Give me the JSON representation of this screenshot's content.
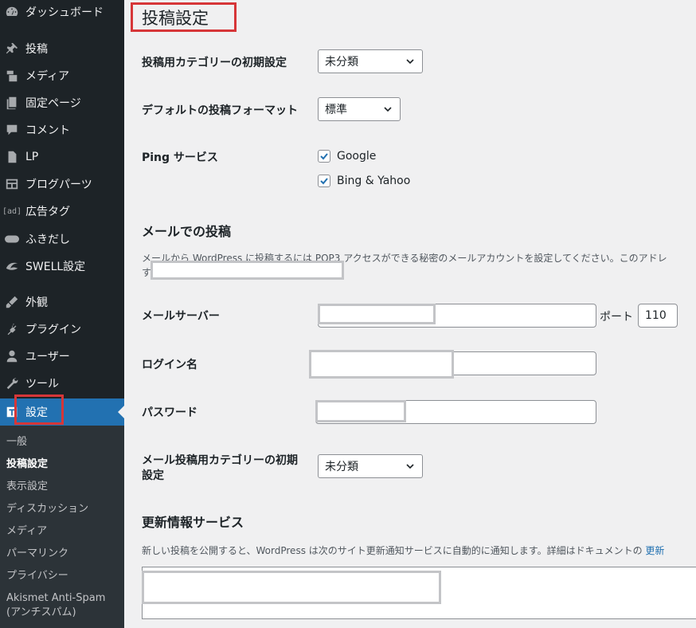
{
  "sidebar": {
    "items": [
      {
        "label": "ダッシュボード",
        "icon": "dashboard-icon"
      },
      {
        "label": "投稿",
        "icon": "pin-icon"
      },
      {
        "label": "メディア",
        "icon": "media-icon"
      },
      {
        "label": "固定ページ",
        "icon": "page-icon"
      },
      {
        "label": "コメント",
        "icon": "comment-icon"
      },
      {
        "label": "LP",
        "icon": "document-icon"
      },
      {
        "label": "ブログパーツ",
        "icon": "layout-icon"
      },
      {
        "label": "広告タグ",
        "icon": "ad-tag-icon",
        "icon_text": "[ad]"
      },
      {
        "label": "ふきだし",
        "icon": "speech-bubble-icon"
      },
      {
        "label": "SWELL設定",
        "icon": "swell-icon"
      },
      {
        "label": "外観",
        "icon": "appearance-icon"
      },
      {
        "label": "プラグイン",
        "icon": "plugin-icon"
      },
      {
        "label": "ユーザー",
        "icon": "user-icon"
      },
      {
        "label": "ツール",
        "icon": "wrench-icon"
      },
      {
        "label": "設定",
        "icon": "settings-icon"
      }
    ],
    "submenu": [
      "一般",
      "投稿設定",
      "表示設定",
      "ディスカッション",
      "メディア",
      "パーマリンク",
      "プライバシー",
      "Akismet Anti-Spam (アンチスパム)"
    ]
  },
  "page": {
    "title": "投稿設定",
    "default_category": {
      "label": "投稿用カテゴリーの初期設定",
      "value": "未分類"
    },
    "default_format": {
      "label": "デフォルトの投稿フォーマット",
      "value": "標準"
    },
    "ping": {
      "label": "Ping サービス",
      "options": [
        {
          "label": "Google",
          "checked": true
        },
        {
          "label": "Bing & Yahoo",
          "checked": true
        }
      ]
    },
    "mail": {
      "title": "メールでの投稿",
      "description_line1": "メールから WordPress に投稿するには POP3 アクセスができる秘密のメールアカウントを設定してください。このアドレ",
      "description_line2": "す",
      "server_label": "メールサーバー",
      "port_label": "ポート",
      "port_value": "110",
      "login_label": "ログイン名",
      "password_label": "パスワード",
      "category_label_line1": "メール投稿用カテゴリーの初期",
      "category_label_line2": "設定",
      "category_value": "未分類"
    },
    "update_services": {
      "title": "更新情報サービス",
      "description": "新しい投稿を公開すると、WordPress は次のサイト更新通知サービスに自動的に通知します。詳細はドキュメントの ",
      "link_text": "更新"
    }
  },
  "colors": {
    "sidebar_bg": "#1d2327",
    "submenu_bg": "#2c3338",
    "accent": "#2271b1",
    "highlight": "#d63638",
    "page_bg": "#f0f0f1"
  }
}
